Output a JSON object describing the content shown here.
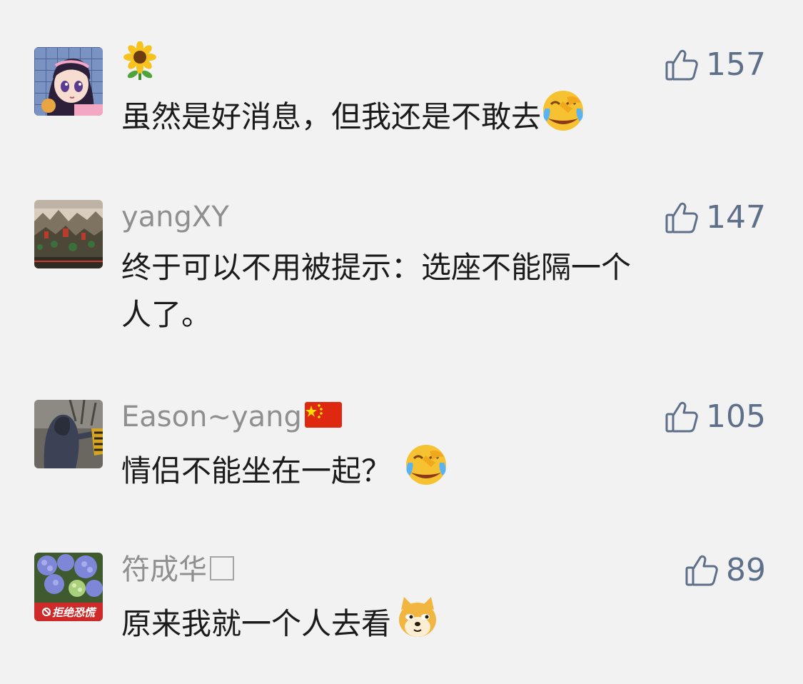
{
  "comments": [
    {
      "username": "",
      "username_icon": "sunflower-icon",
      "text": "虽然是好消息，但我还是不敢去",
      "text_emoji": "laughing-crying-emoji-icon",
      "likes": "157",
      "avatar_icon": "anime-girl-avatar"
    },
    {
      "username": "yangXY",
      "text_line1": "终于可以不用被提示：选座不能隔一个",
      "text_line2": "人了。",
      "likes": "147",
      "avatar_icon": "landscape-painting-avatar"
    },
    {
      "username": "Eason~yang",
      "username_icon": "china-flag-icon",
      "text": "情侣不能坐在一起？",
      "text_emoji": "laughing-crying-emoji-icon",
      "likes": "105",
      "avatar_icon": "hooded-person-avatar"
    },
    {
      "username": "符成华",
      "username_icon": "empty-box-icon",
      "text": "原来我就一个人去看",
      "text_emoji": "doge-emoji-icon",
      "likes": "89",
      "avatar_icon": "hydrangea-avatar",
      "avatar_badge": "拒绝恐慌"
    }
  ],
  "colors": {
    "background": "#f2f2f2",
    "username": "#8f8f8f",
    "text": "#1b1b1b",
    "likes": "#5e6f8a"
  }
}
